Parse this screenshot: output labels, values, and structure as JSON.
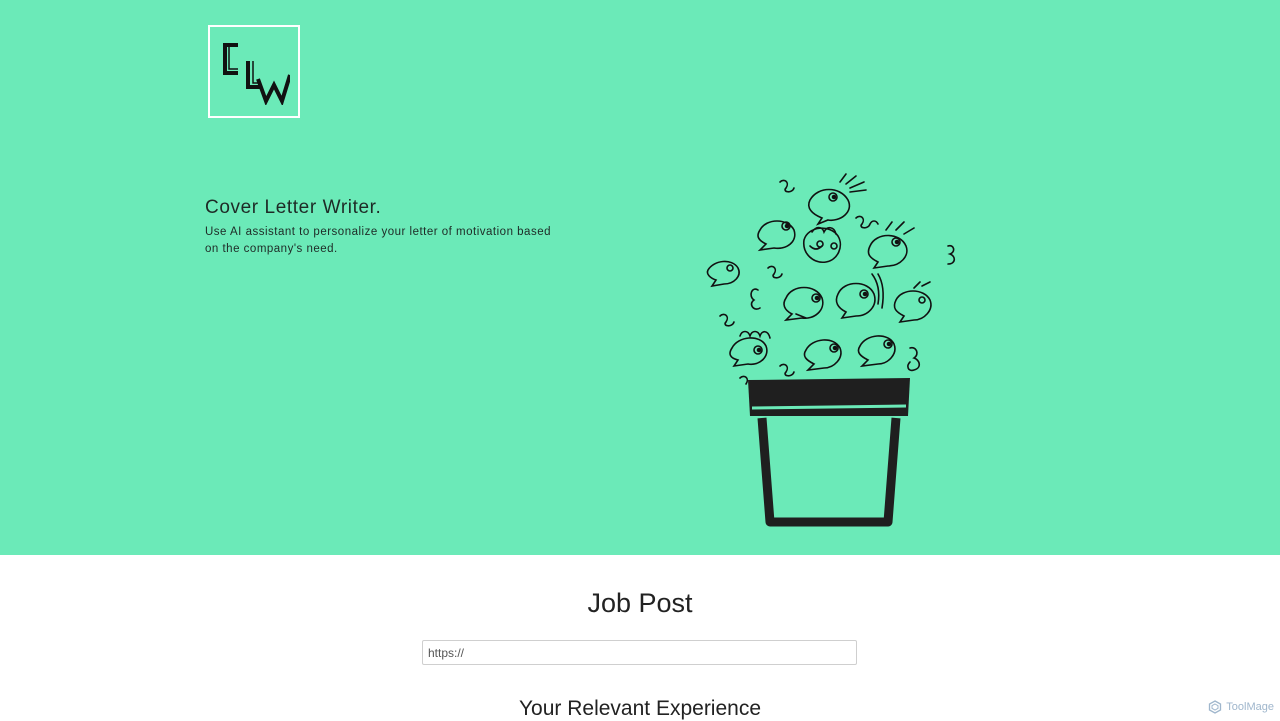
{
  "logo": {
    "letters": "CLW"
  },
  "hero": {
    "title": "Cover Letter Writer.",
    "description": "Use AI assistant to personalize your letter of motivation based on the company's need.",
    "background_color": "#6beab8",
    "illustration": "plant-pot-of-faces-illustration"
  },
  "job_post": {
    "title": "Job Post",
    "url_placeholder": "https://"
  },
  "experience": {
    "title": "Your Relevant Experience"
  },
  "watermark": {
    "label": "ToolMage",
    "icon": "hexagon-icon"
  }
}
